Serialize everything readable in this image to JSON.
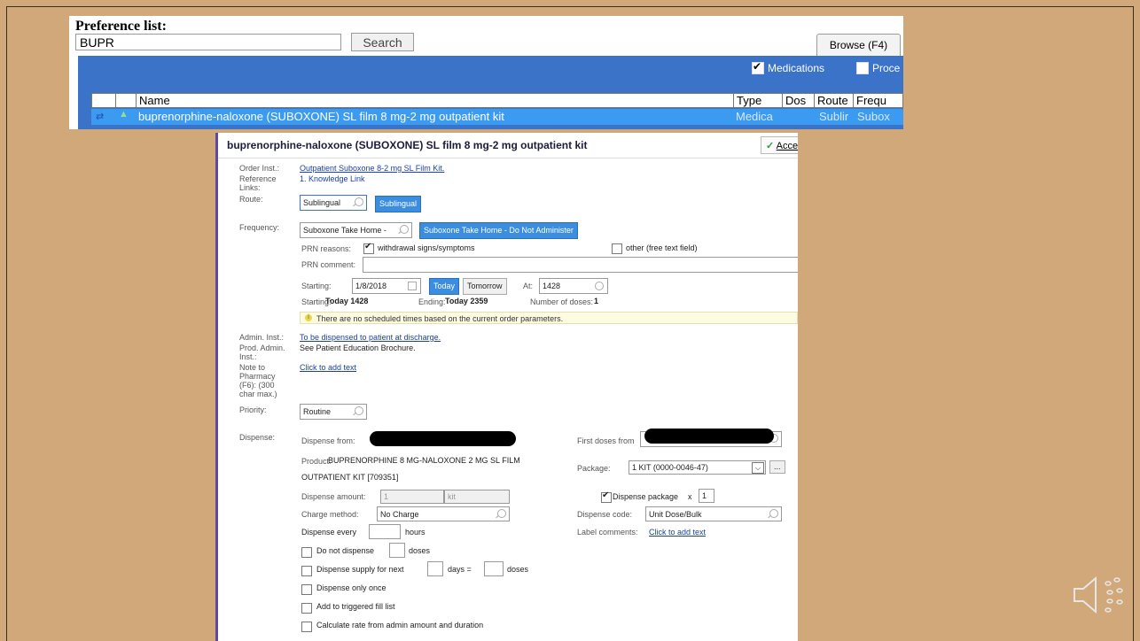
{
  "pref_list": {
    "title": "Preference list:",
    "search_value": "BUPR",
    "search_button": "Search",
    "browse_tab": "Browse (F4)",
    "filters": [
      {
        "label": "Medications",
        "checked": true
      },
      {
        "label": "Proce",
        "checked": false
      }
    ],
    "columns": [
      "Name",
      "Type",
      "Dos",
      "Route",
      "Frequ"
    ],
    "row": {
      "name": "buprenorphine-naloxone (SUBOXONE) SL film 8 mg-2 mg outpatient kit",
      "type": "Medica",
      "route": "Sublir",
      "frequency": "Subox"
    }
  },
  "order": {
    "title": "buprenorphine-naloxone (SUBOXONE) SL film 8 mg-2 mg outpatient kit",
    "accept": "Acce",
    "order_inst_label": "Order Inst.:",
    "order_inst_value": "Outpatient Suboxone 8-2 mg SL Film Kit.",
    "reference_label": "Reference Links:",
    "reference_value": "1. Knowledge Link",
    "route_label": "Route:",
    "route_value": "Sublingual",
    "route_button": "Sublingual",
    "frequency_label": "Frequency:",
    "frequency_value": "Suboxone Take Home -",
    "frequency_button": "Suboxone Take Home - Do Not Administer",
    "prn_reasons_label": "PRN reasons:",
    "prn_reason_1": "withdrawal signs/symptoms",
    "prn_reason_2": "other (free text field)",
    "prn_comment_label": "PRN comment:",
    "starting_label": "Starting:",
    "starting_date": "1/8/2018",
    "today_button": "Today",
    "tomorrow_button": "Tomorrow",
    "at_label": "At:",
    "at_value": "1428",
    "starting_summary_label": "Starting:",
    "starting_summary_value": "Today 1428",
    "ending_label": "Ending:",
    "ending_value": "Today 2359",
    "doses_label": "Number of doses:",
    "doses_value": "1",
    "notice": "There are no scheduled times based on the current order parameters.",
    "admin_inst_label": "Admin. Inst.:",
    "admin_inst_value": "To be dispensed to patient at discharge.",
    "prod_admin_label": "Prod. Admin. Inst.:",
    "prod_admin_value": "See Patient Education Brochure.",
    "note_label": "Note to Pharmacy (F6): (300 char max.)",
    "note_value": "Click to add text",
    "priority_label": "Priority:",
    "priority_value": "Routine",
    "dispense_label": "Dispense:",
    "dispense_from_label": "Dispense from:",
    "first_doses_label": "First doses from",
    "first_doses_suffix": "Y",
    "product_label": "Product:",
    "product_value_1": "BUPRENORPHINE 8 MG-NALOXONE 2 MG SL FILM",
    "product_value_2": "OUTPATIENT KIT [709351]",
    "package_label": "Package:",
    "package_value": "1 KIT (0000-0046-47)",
    "dispense_amount_label": "Dispense amount:",
    "dispense_amount_value": "1",
    "dispense_amount_unit": "kit",
    "dispense_package_label": "Dispense package",
    "dispense_package_x": "x",
    "dispense_package_value": "1",
    "charge_method_label": "Charge method:",
    "charge_method_value": "No Charge",
    "dispense_code_label": "Dispense code:",
    "dispense_code_value": "Unit Dose/Bulk",
    "dispense_every_label": "Dispense every",
    "hours_label": "hours",
    "label_comments_label": "Label comments:",
    "label_comments_value": "Click to add text",
    "do_not_dispense": "Do not dispense",
    "doses_word": "doses",
    "dispense_supply": "Dispense supply for next",
    "days_eq": "days =",
    "dispense_once": "Dispense only once",
    "add_triggered": "Add to triggered fill list",
    "calc_rate": "Calculate rate from admin amount and duration"
  },
  "colors": {
    "background": "#d0a87a",
    "list_bar": "#3b73c9",
    "selected_row": "#3b9bf0",
    "action_button": "#3b8de0"
  }
}
